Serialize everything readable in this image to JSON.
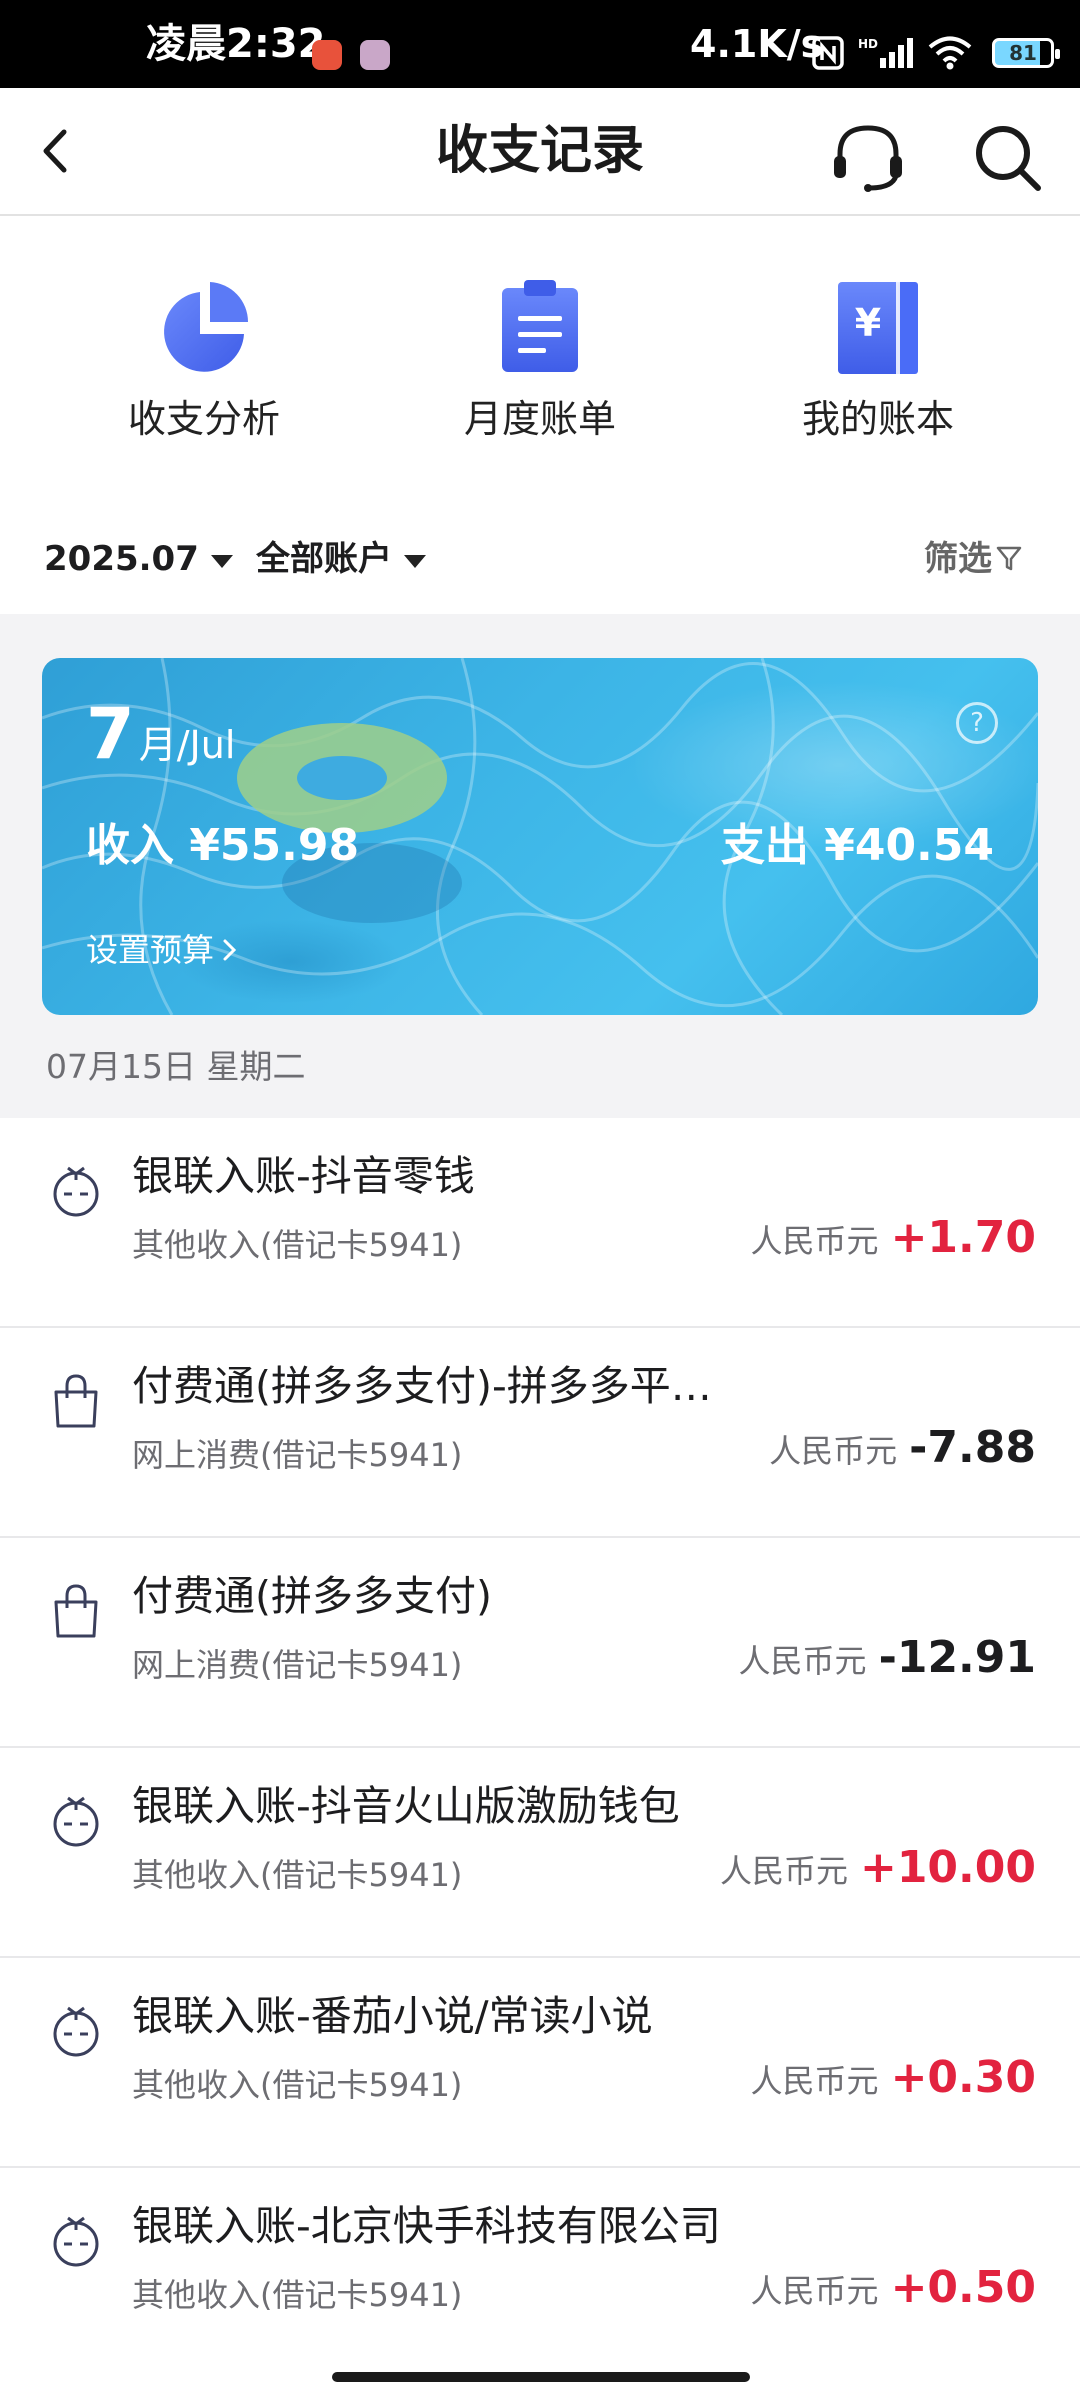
{
  "status_bar": {
    "time": "凌晨2:32",
    "network_speed": "4.1K/s",
    "battery": "81"
  },
  "header": {
    "title": "收支记录",
    "back_icon": "chevron-left-icon",
    "service_icon": "headset-icon",
    "search_icon": "search-icon"
  },
  "quick_entries": [
    {
      "label": "收支分析",
      "icon": "pie-chart-icon"
    },
    {
      "label": "月度账单",
      "icon": "clipboard-icon"
    },
    {
      "label": "我的账本",
      "icon": "ledger-book-icon"
    }
  ],
  "filters": {
    "month": "2025.07",
    "account": "全部账户",
    "filter_label": "筛选"
  },
  "summary_card": {
    "month_number": "7",
    "month_unit": "月/Jul",
    "income": "收入 ¥55.98",
    "expense": "支出 ¥40.54",
    "budget_link": "设置预算",
    "help": "?"
  },
  "date_header": "07月15日 星期二",
  "transactions": [
    {
      "name": "银联入账-抖音零钱",
      "sub": "其他收入(借记卡5941)",
      "currency": "人民币元",
      "amount": "+1.70",
      "type": "income"
    },
    {
      "name": "付费通(拼多多支付)-拼多多平…",
      "sub": "网上消费(借记卡5941)",
      "currency": "人民币元",
      "amount": "-7.88",
      "type": "expense"
    },
    {
      "name": "付费通(拼多多支付)",
      "sub": "网上消费(借记卡5941)",
      "currency": "人民币元",
      "amount": "-12.91",
      "type": "expense"
    },
    {
      "name": "银联入账-抖音火山版激励钱包",
      "sub": "其他收入(借记卡5941)",
      "currency": "人民币元",
      "amount": "+10.00",
      "type": "income"
    },
    {
      "name": "银联入账-番茄小说/常读小说",
      "sub": "其他收入(借记卡5941)",
      "currency": "人民币元",
      "amount": "+0.30",
      "type": "income"
    },
    {
      "name": "银联入账-北京快手科技有限公司",
      "sub": "其他收入(借记卡5941)",
      "currency": "人民币元",
      "amount": "+0.50",
      "type": "income"
    }
  ],
  "colors": {
    "income_amount": "#e2233f",
    "expense_amount": "#1d1d1f",
    "icon_blue": "#4a6cf7"
  }
}
